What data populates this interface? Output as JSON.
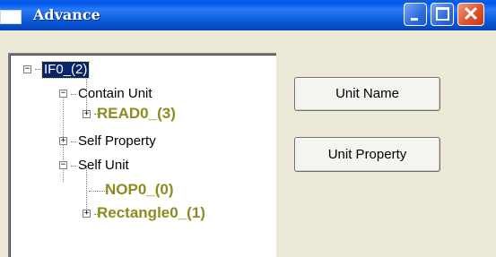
{
  "window": {
    "title": "Advance",
    "controls": {
      "minimize": "minimize-icon",
      "maximize": "maximize-icon",
      "close": "close-icon",
      "close_glyph": "✕"
    }
  },
  "tree": {
    "expander_expanded": "−",
    "expander_collapsed": "+",
    "nodes": [
      {
        "label": "IF0_(2)",
        "selected": true,
        "expanded": true
      },
      {
        "label": "Contain Unit",
        "expanded": true
      },
      {
        "label": "READ0_(3)",
        "expanded": false,
        "highlight": true
      },
      {
        "label": "Self Property",
        "expanded": false
      },
      {
        "label": "Self Unit",
        "expanded": true
      },
      {
        "label": "NOP0_(0)",
        "highlight": true
      },
      {
        "label": "Rectangle0_(1)",
        "expanded": false,
        "highlight": true
      }
    ]
  },
  "buttons": {
    "unit_name": "Unit Name",
    "unit_property": "Unit Property"
  },
  "colors": {
    "highlight_text": "#8C8C1E",
    "selection_bg": "#0A246A",
    "titlebar": "#0058EE",
    "dialog_bg": "#ECE9D8"
  }
}
